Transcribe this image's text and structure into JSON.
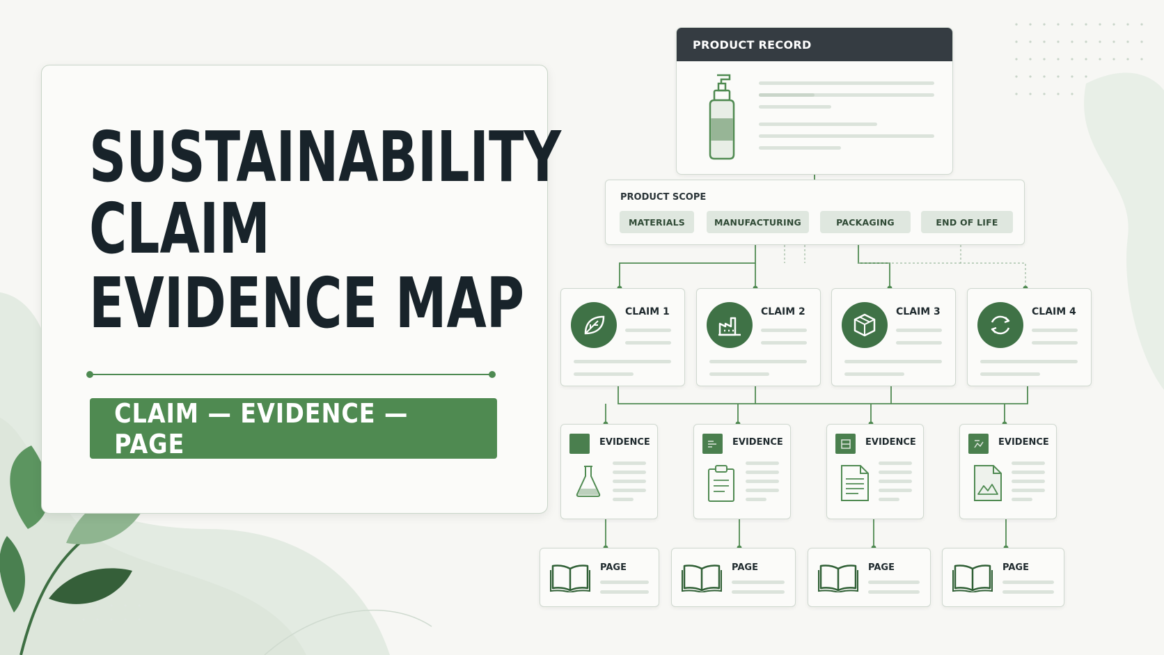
{
  "title": {
    "line1": "SUSTAINABILITY",
    "line2": "CLAIM",
    "line3": "EVIDENCE MAP",
    "banner": "CLAIM — EVIDENCE — PAGE"
  },
  "product_record": {
    "header": "PRODUCT RECORD",
    "icon": "pump-bottle-icon"
  },
  "product_scope": {
    "title": "PRODUCT SCOPE",
    "chips": [
      "MATERIALS",
      "MANUFACTURING",
      "PACKAGING",
      "END OF LIFE"
    ]
  },
  "claims": [
    {
      "label": "CLAIM 1",
      "icon": "leaf-icon"
    },
    {
      "label": "CLAIM 2",
      "icon": "factory-icon"
    },
    {
      "label": "CLAIM 3",
      "icon": "box-icon"
    },
    {
      "label": "CLAIM 4",
      "icon": "recycle-icon"
    }
  ],
  "evidence": [
    {
      "label": "EVIDENCE",
      "icon": "flask-icon"
    },
    {
      "label": "EVIDENCE",
      "icon": "clipboard-icon"
    },
    {
      "label": "EVIDENCE",
      "icon": "document-icon"
    },
    {
      "label": "EVIDENCE",
      "icon": "image-document-icon"
    }
  ],
  "pages": [
    {
      "label": "PAGE",
      "icon": "open-book-icon"
    },
    {
      "label": "PAGE",
      "icon": "open-book-icon"
    },
    {
      "label": "PAGE",
      "icon": "open-book-icon"
    },
    {
      "label": "PAGE",
      "icon": "open-book-icon"
    }
  ],
  "colors": {
    "accent": "#4f8a51",
    "dark_header": "#353c42",
    "icon_fill": "#3f7246",
    "chip_bg": "#dfe7df",
    "background": "#f7f7f4"
  }
}
